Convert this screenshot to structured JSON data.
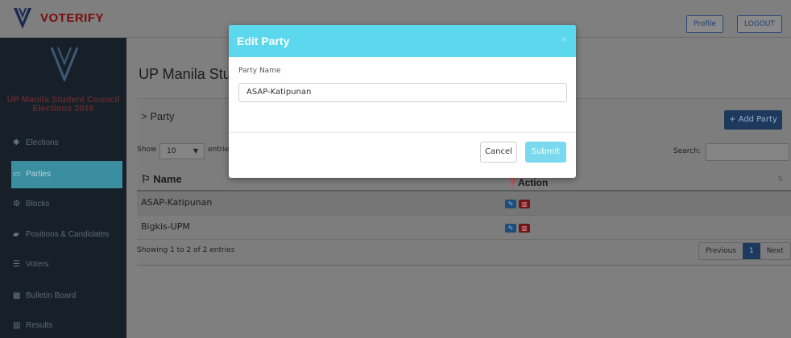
{
  "navbar": {
    "brand": "VOTERIFY",
    "profile_label": "Profile",
    "logout_label": "LOGOUT"
  },
  "sidebar": {
    "title_line1": "UP Manila Student Council",
    "title_line2": "Elections 2016",
    "items": [
      {
        "label": "Elections",
        "icon": "dashboard-icon",
        "glyph": "✱"
      },
      {
        "label": "Parties",
        "icon": "monitor-icon",
        "glyph": "▭"
      },
      {
        "label": "Blocks",
        "icon": "gears-icon",
        "glyph": "⚙"
      },
      {
        "label": "Positions & Candidates",
        "icon": "book-icon",
        "glyph": "▰"
      },
      {
        "label": "Voters",
        "icon": "list-icon",
        "glyph": "☰"
      },
      {
        "label": "Bulletin Board",
        "icon": "table-icon",
        "glyph": "▦"
      },
      {
        "label": "Results",
        "icon": "bar-chart-icon",
        "glyph": "▥"
      }
    ]
  },
  "main": {
    "page_title": "UP Manila Stud",
    "breadcrumb": "> Party",
    "add_button": "+ Add Party",
    "show_label": "Show",
    "show_value": "10",
    "entries_label": "entries",
    "search_label": "Search:",
    "columns": {
      "name": "Name",
      "action": "Action"
    },
    "rows": [
      {
        "name": "ASAP-Katipunan"
      },
      {
        "name": "Bigkis-UPM"
      }
    ],
    "showing": "Showing 1 to 2 of 2 entries",
    "pager": {
      "previous": "Previous",
      "current": "1",
      "next": "Next"
    }
  },
  "modal": {
    "title": "Edit Party",
    "close": "×",
    "field_label": "Party Name",
    "field_value": "ASAP-Katipunan",
    "cancel_label": "Cancel",
    "submit_label": "Submit"
  },
  "colors": {
    "modal_header": "#5bd8ee",
    "submit": "#7ad9ee",
    "sidebar_active": "#3a8ea0",
    "add_button": "#1d3a5e",
    "brand": "#7a0c0c"
  }
}
